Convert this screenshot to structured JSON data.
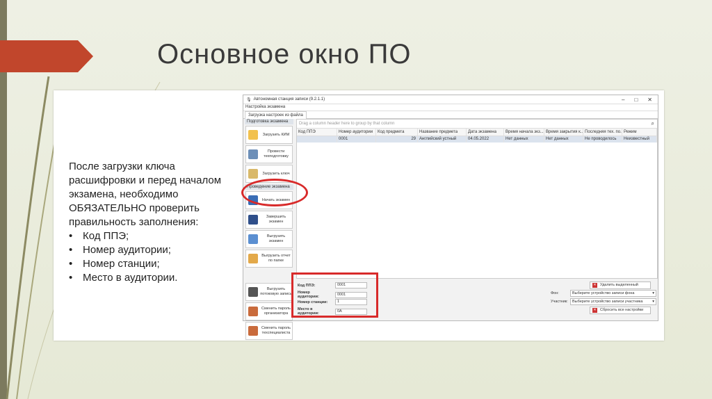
{
  "slide": {
    "title": "Основное окно ПО",
    "instructions": "После загрузки ключа расшифровки и перед началом экзамена, необходимо ОБЯЗАТЕЛЬНО проверить правильность заполнения:",
    "bullets": [
      "Код ППЭ;",
      "Номер аудитории;",
      "Номер станции;",
      "Место в аудитории."
    ]
  },
  "app": {
    "title": "Автономная станция записи (9.2.1.1)",
    "menu": "Настройка экзамена",
    "tab": "Загрузка настроек из файла",
    "sidebar": {
      "group1": "Подготовка экзамена",
      "buttons1": [
        "Загрузить КИМ",
        "Провести техподготовку",
        "Загрузить ключ"
      ],
      "group2": "Проведение экзамена",
      "buttons2": [
        "Начать экзамен",
        "Завершить экзамен",
        "Выгрузить экзамен",
        "Выгрузить отчет по папке"
      ],
      "buttons3": [
        "Выгрузить потоковую запись",
        "Сменить пароль организатора",
        "Сменить пароль техспециалиста"
      ]
    },
    "grid": {
      "hint": "Drag a column header here to group by that column",
      "columns": [
        "Код ППЭ",
        "Номер аудитории",
        "Код предмета",
        "Название предмета",
        "Дата экзамена",
        "Время начала экз...",
        "Время закрытия к...",
        "Последняя тех. по...",
        "Режим"
      ],
      "rows": [
        [
          "",
          "0001",
          "29",
          "Английский устный",
          "04.05.2022",
          "Нет данных",
          "Нет данных",
          "Не проводилось",
          "Неизвестный"
        ]
      ]
    },
    "fields": [
      {
        "label": "Код ППЭ:",
        "value": "0001"
      },
      {
        "label": "Номер аудитории:",
        "value": "0001"
      },
      {
        "label": "Номер станции:",
        "value": "1"
      },
      {
        "label": "Место в аудитории:",
        "value": "0А"
      }
    ],
    "delete_button": "Удалить выделенный экзамен",
    "selects": [
      {
        "label": "Фон:",
        "value": "Выберите устройство записи фона"
      },
      {
        "label": "Участник:",
        "value": "Выберите устройство записи участника"
      }
    ],
    "reset_button": "Сбросить все настройки"
  },
  "colors": {
    "accent_red": "#d82a2a",
    "arrow": "#c1462c",
    "bar": "#7c7a5e"
  }
}
